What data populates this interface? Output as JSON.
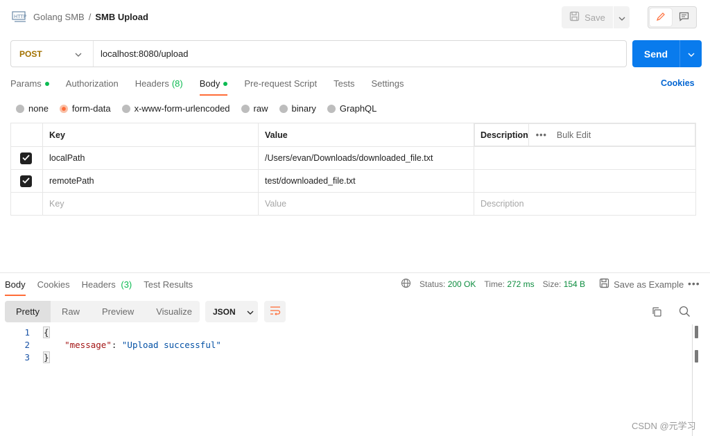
{
  "header": {
    "collection": "Golang SMB",
    "separator": "/",
    "request_name": "SMB Upload",
    "save_label": "Save"
  },
  "request": {
    "method": "POST",
    "url": "localhost:8080/upload",
    "send_label": "Send"
  },
  "request_tabs": [
    {
      "label": "Params",
      "dot": true
    },
    {
      "label": "Authorization"
    },
    {
      "label": "Headers",
      "count": "(8)"
    },
    {
      "label": "Body",
      "dot": true,
      "active": true
    },
    {
      "label": "Pre-request Script"
    },
    {
      "label": "Tests"
    },
    {
      "label": "Settings"
    }
  ],
  "cookies_label": "Cookies",
  "body_types": [
    {
      "label": "none"
    },
    {
      "label": "form-data",
      "selected": true
    },
    {
      "label": "x-www-form-urlencoded"
    },
    {
      "label": "raw"
    },
    {
      "label": "binary"
    },
    {
      "label": "GraphQL"
    }
  ],
  "params_table": {
    "headers": {
      "key": "Key",
      "value": "Value",
      "description": "Description",
      "bulk_edit": "Bulk Edit"
    },
    "rows": [
      {
        "key": "localPath",
        "value": "/Users/evan/Downloads/downloaded_file.txt",
        "description": "",
        "checked": true
      },
      {
        "key": "remotePath",
        "value": "test/downloaded_file.txt",
        "description": "",
        "checked": true
      }
    ],
    "placeholders": {
      "key": "Key",
      "value": "Value",
      "description": "Description"
    }
  },
  "response": {
    "tabs": [
      {
        "label": "Body",
        "active": true
      },
      {
        "label": "Cookies"
      },
      {
        "label": "Headers",
        "count": "(3)"
      },
      {
        "label": "Test Results"
      }
    ],
    "status_label": "Status:",
    "status_value": "200 OK",
    "time_label": "Time:",
    "time_value": "272 ms",
    "size_label": "Size:",
    "size_value": "154 B",
    "save_example": "Save as Example",
    "formats": [
      "Pretty",
      "Raw",
      "Preview",
      "Visualize"
    ],
    "language": "JSON",
    "code": {
      "line_numbers": [
        "1",
        "2",
        "3"
      ],
      "open_brace": "{",
      "key": "\"message\"",
      "colon": ": ",
      "value": "\"Upload successful\"",
      "close_brace": "}"
    }
  },
  "watermark": "CSDN @元学习",
  "colors": {
    "accent": "#ff6c37",
    "send": "#097bed",
    "status_ok": "#0c8c3e",
    "method": "#a37200"
  }
}
